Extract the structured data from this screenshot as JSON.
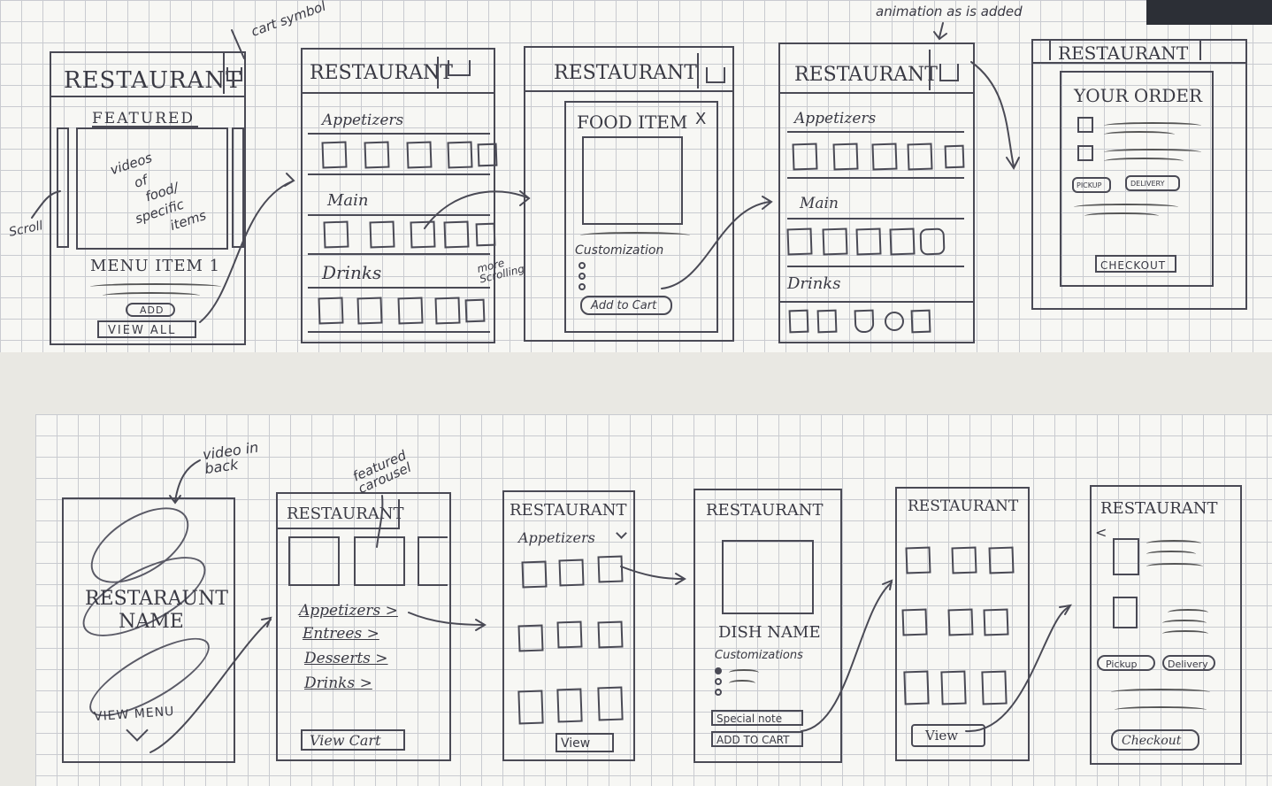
{
  "notes": {
    "cart_symbol": "cart symbol",
    "animation": "animation as is added",
    "scroll": "Scroll",
    "more_scrolling": "more Scrolling",
    "video_in_back": "video in back",
    "featured_carousel": "featured carousel"
  },
  "top_row": {
    "s1": {
      "title": "RESTAURANT",
      "featured": "FEATURED",
      "videos": [
        "videos",
        "of",
        "food/",
        "specific",
        "items"
      ],
      "menu_item": "MENU ITEM 1",
      "add": "ADD",
      "view_all": "VIEW ALL"
    },
    "s2": {
      "title": "RESTAURANT",
      "appetizers": "Appetizers",
      "main": "Main",
      "drinks": "Drinks"
    },
    "s3": {
      "title": "RESTAURANT",
      "food_item": "FOOD ITEM",
      "close": "X",
      "customization": "Customization",
      "add_to_cart": "Add to Cart"
    },
    "s4": {
      "title": "RESTAURANT",
      "appetizers": "Appetizers",
      "main": "Main",
      "drinks": "Drinks"
    },
    "s5": {
      "title": "RESTAURANT",
      "your_order": "YOUR ORDER",
      "pickup": "PICKUP",
      "delivery": "DELIVERY",
      "checkout": "CHECKOUT"
    }
  },
  "bottom_row": {
    "b1": {
      "name": "RESTARAUNT NAME",
      "view_menu": "VIEW MENU"
    },
    "b2": {
      "title": "RESTAURANT",
      "links": [
        "Appetizers >",
        "Entrees >",
        "Desserts >",
        "Drinks >"
      ],
      "view_cart": "View Cart"
    },
    "b3": {
      "title": "RESTAURANT",
      "section": "Appetizers",
      "view": "View"
    },
    "b4": {
      "title": "RESTAURANT",
      "dish_name": "DISH NAME",
      "customizations": "Customizations",
      "special_note": "Special note",
      "add_to_cart": "ADD TO CART"
    },
    "b5": {
      "title": "RESTAURANT",
      "view": "View"
    },
    "b6": {
      "title": "RESTAURANT",
      "back": "<",
      "pickup": "Pickup",
      "delivery": "Delivery",
      "checkout": "Checkout"
    }
  }
}
